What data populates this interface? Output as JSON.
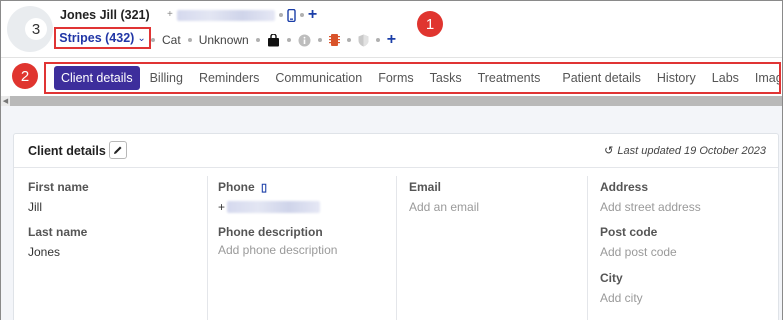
{
  "client": {
    "name": "Jones Jill",
    "number": "(321)"
  },
  "patient": {
    "name": "Stripes (432)",
    "species": "Cat",
    "sex": "Unknown"
  },
  "header_icons": [
    "phone-icon",
    "add-icon",
    "bag-icon",
    "info-icon",
    "microchip-icon",
    "shield-icon",
    "add-icon"
  ],
  "badges": {
    "one": "1",
    "two": "2",
    "three": "3"
  },
  "tabs": [
    {
      "label": "Client details"
    },
    {
      "label": "Billing"
    },
    {
      "label": "Reminders"
    },
    {
      "label": "Communication"
    },
    {
      "label": "Forms"
    },
    {
      "label": "Tasks"
    },
    {
      "label": "Treatments"
    },
    {
      "label": "Patient details"
    },
    {
      "label": "History"
    },
    {
      "label": "Labs"
    },
    {
      "label": "Imaging"
    }
  ],
  "card": {
    "title": "Client details",
    "last_updated": "Last updated 19 October 2023"
  },
  "fields": {
    "first_name_label": "First name",
    "first_name": "Jill",
    "last_name_label": "Last name",
    "last_name": "Jones",
    "phone_label": "Phone",
    "phone_prefix": "+",
    "phone_desc_label": "Phone description",
    "phone_desc_placeholder": "Add phone description",
    "email_label": "Email",
    "email_placeholder": "Add an email",
    "address_label": "Address",
    "address_placeholder": "Add street address",
    "postcode_label": "Post code",
    "postcode_placeholder": "Add post code",
    "city_label": "City",
    "city_placeholder": "Add city"
  },
  "colors": {
    "accent": "#3d2e9c",
    "link": "#2136a6",
    "annotation": "#e0352f"
  }
}
